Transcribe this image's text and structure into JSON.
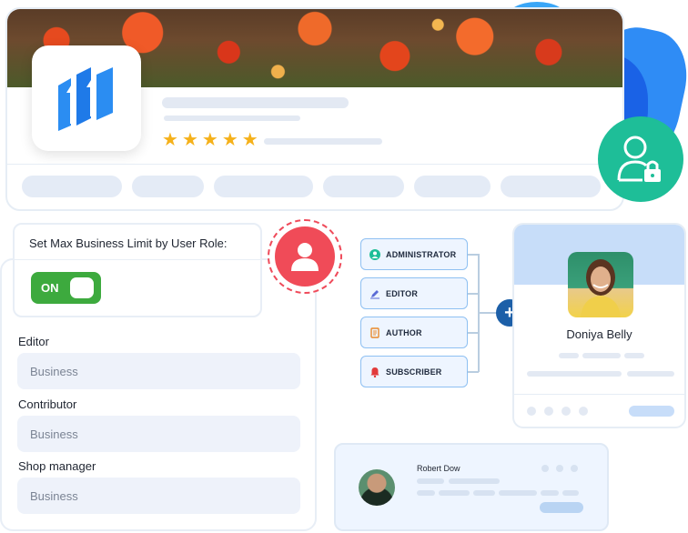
{
  "business": {
    "rating_stars": 5,
    "star_glyph": "★",
    "tab_count": 6,
    "logo_icon": "bar-chart-arrows-icon"
  },
  "lock_badge": {
    "icon": "user-lock-icon",
    "color": "#1ebe98"
  },
  "limit_settings": {
    "title": "Set Max Business Limit by User Role:",
    "toggle": {
      "label": "ON",
      "state": "on",
      "color": "#3daa3e"
    },
    "fields": [
      {
        "label": "Editor",
        "placeholder": "Business"
      },
      {
        "label": "Contributor",
        "placeholder": "Business"
      },
      {
        "label": "Shop manager",
        "placeholder": "Business"
      }
    ]
  },
  "user_badge": {
    "icon": "user-icon",
    "color": "#f04b58"
  },
  "roles": [
    {
      "label": "ADMINISTRATOR",
      "icon": "user-circle-icon",
      "icon_color": "#1ebe98"
    },
    {
      "label": "EDITOR",
      "icon": "pencil-icon",
      "icon_color": "#5b6bd6"
    },
    {
      "label": "AUTHOR",
      "icon": "document-icon",
      "icon_color": "#e98a2b"
    },
    {
      "label": "SUBSCRIBER",
      "icon": "bell-icon",
      "icon_color": "#e23b3b"
    }
  ],
  "add_symbol": "+",
  "profile": {
    "name": "Doniya Belly"
  },
  "user_row": {
    "name": "Robert Dow"
  }
}
